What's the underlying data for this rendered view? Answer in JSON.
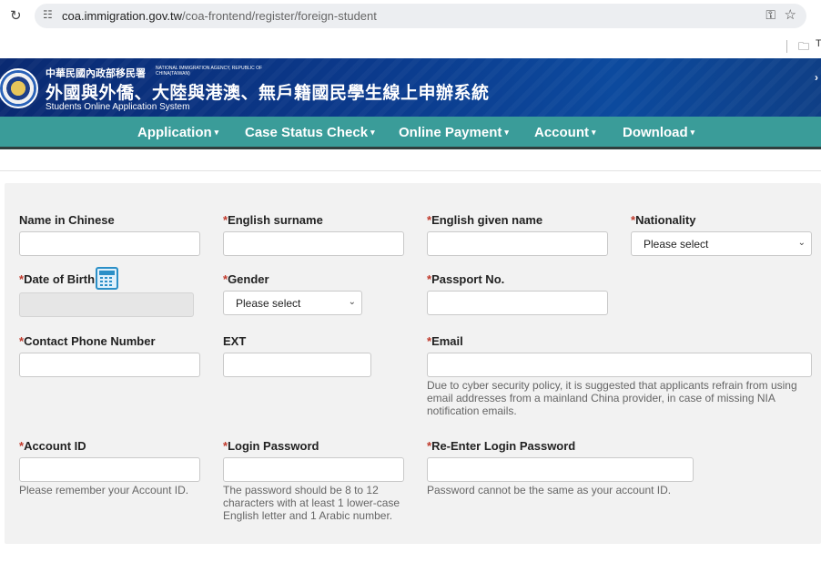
{
  "browser": {
    "url_domain": "coa.immigration.gov.tw",
    "url_path": "/coa-frontend/register/foreign-student",
    "bookmark_folder": "T"
  },
  "header": {
    "org_cn": "中華民國內政部移民署",
    "org_en": "NATIONAL IMMIGRATION AGENCY, REPUBLIC OF CHINA(TAIWAN)",
    "system_cn": "外國與外僑、大陸與港澳、無戶籍國民學生線上申辦系統",
    "system_en": "Students Online Application System",
    "arrow": "›",
    "colors": {
      "header_bg": "#0b3a8c",
      "nav_bg": "#3a9c99",
      "required": "#c0392b"
    }
  },
  "nav": {
    "items": [
      {
        "label": "Application"
      },
      {
        "label": "Case Status Check"
      },
      {
        "label": "Online Payment"
      },
      {
        "label": "Account"
      },
      {
        "label": "Download"
      }
    ],
    "caret": "▾"
  },
  "form": {
    "required_mark": "*",
    "name_chinese": {
      "label": "Name in Chinese",
      "value": ""
    },
    "english_surname": {
      "label": "English surname",
      "value": ""
    },
    "english_given_name": {
      "label": "English given name",
      "value": ""
    },
    "nationality": {
      "label": "Nationality",
      "selected": "Please select"
    },
    "date_of_birth": {
      "label": "Date of Birth",
      "value": ""
    },
    "gender": {
      "label": "Gender",
      "selected": "Please select"
    },
    "passport_no": {
      "label": "Passport No.",
      "value": ""
    },
    "contact_phone": {
      "label": "Contact Phone Number",
      "value": ""
    },
    "ext": {
      "label": "EXT",
      "value": ""
    },
    "email": {
      "label": "Email",
      "value": "",
      "help": "Due to cyber security policy, it is suggested that applicants refrain from using email addresses from a mainland China provider, in case of missing NIA notification emails."
    },
    "account_id": {
      "label": "Account ID",
      "value": "",
      "help": "Please remember your Account ID."
    },
    "login_password": {
      "label": "Login Password",
      "value": "",
      "help": "The password should be 8 to 12 characters with at least 1 lower-case English letter and 1 Arabic number."
    },
    "reenter_password": {
      "label": "Re-Enter Login Password",
      "value": "",
      "help": "Password cannot be the same as your account ID."
    }
  }
}
